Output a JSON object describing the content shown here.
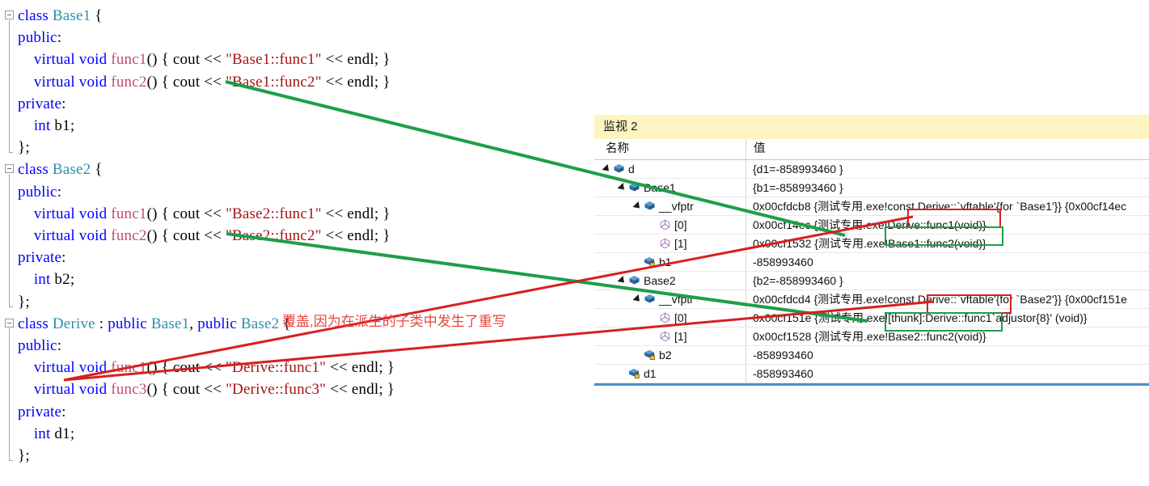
{
  "code": {
    "lines": [
      {
        "indent": 0,
        "tokens": [
          {
            "t": "class ",
            "c": "kw"
          },
          {
            "t": "Base1",
            "c": "typ"
          },
          {
            "t": " {",
            "c": "pl"
          }
        ]
      },
      {
        "indent": 0,
        "tokens": [
          {
            "t": "public",
            "c": "kw"
          },
          {
            "t": ":",
            "c": "pl"
          }
        ]
      },
      {
        "indent": 0,
        "tokens": [
          {
            "t": "    ",
            "c": "pl"
          },
          {
            "t": "virtual void ",
            "c": "kw"
          },
          {
            "t": "func1",
            "c": "fn"
          },
          {
            "t": "() { cout << ",
            "c": "pl"
          },
          {
            "t": "\"Base1::func1\"",
            "c": "str"
          },
          {
            "t": " << endl; }",
            "c": "pl"
          }
        ]
      },
      {
        "indent": 0,
        "tokens": [
          {
            "t": "    ",
            "c": "pl"
          },
          {
            "t": "virtual void ",
            "c": "kw"
          },
          {
            "t": "func2",
            "c": "fn"
          },
          {
            "t": "() { cout << ",
            "c": "pl"
          },
          {
            "t": "\"Base1::func2\"",
            "c": "str"
          },
          {
            "t": " << endl; }",
            "c": "pl"
          }
        ]
      },
      {
        "indent": 0,
        "tokens": [
          {
            "t": "private",
            "c": "kw"
          },
          {
            "t": ":",
            "c": "pl"
          }
        ]
      },
      {
        "indent": 0,
        "tokens": [
          {
            "t": "    ",
            "c": "pl"
          },
          {
            "t": "int ",
            "c": "kw"
          },
          {
            "t": "b1;",
            "c": "pl"
          }
        ]
      },
      {
        "indent": 0,
        "tokens": [
          {
            "t": "};",
            "c": "pl"
          }
        ]
      },
      {
        "indent": 0,
        "tokens": [
          {
            "t": "class ",
            "c": "kw"
          },
          {
            "t": "Base2",
            "c": "typ"
          },
          {
            "t": " {",
            "c": "pl"
          }
        ]
      },
      {
        "indent": 0,
        "tokens": [
          {
            "t": "public",
            "c": "kw"
          },
          {
            "t": ":",
            "c": "pl"
          }
        ]
      },
      {
        "indent": 0,
        "tokens": [
          {
            "t": "    ",
            "c": "pl"
          },
          {
            "t": "virtual void ",
            "c": "kw"
          },
          {
            "t": "func1",
            "c": "fn"
          },
          {
            "t": "() { cout << ",
            "c": "pl"
          },
          {
            "t": "\"Base2::func1\"",
            "c": "str"
          },
          {
            "t": " << endl; }",
            "c": "pl"
          }
        ]
      },
      {
        "indent": 0,
        "tokens": [
          {
            "t": "    ",
            "c": "pl"
          },
          {
            "t": "virtual void ",
            "c": "kw"
          },
          {
            "t": "func2",
            "c": "fn"
          },
          {
            "t": "() { cout << ",
            "c": "pl"
          },
          {
            "t": "\"Base2::func2\"",
            "c": "str"
          },
          {
            "t": " << endl; }",
            "c": "pl"
          }
        ]
      },
      {
        "indent": 0,
        "tokens": [
          {
            "t": "private",
            "c": "kw"
          },
          {
            "t": ":",
            "c": "pl"
          }
        ]
      },
      {
        "indent": 0,
        "tokens": [
          {
            "t": "    ",
            "c": "pl"
          },
          {
            "t": "int ",
            "c": "kw"
          },
          {
            "t": "b2;",
            "c": "pl"
          }
        ]
      },
      {
        "indent": 0,
        "tokens": [
          {
            "t": "};",
            "c": "pl"
          }
        ]
      },
      {
        "indent": 0,
        "tokens": [
          {
            "t": "class ",
            "c": "kw"
          },
          {
            "t": "Derive",
            "c": "typ"
          },
          {
            "t": " : ",
            "c": "pl"
          },
          {
            "t": "public ",
            "c": "kw"
          },
          {
            "t": "Base1",
            "c": "typ"
          },
          {
            "t": ", ",
            "c": "pl"
          },
          {
            "t": "public ",
            "c": "kw"
          },
          {
            "t": "Base2",
            "c": "typ"
          },
          {
            "t": " {",
            "c": "pl"
          }
        ]
      },
      {
        "indent": 0,
        "tokens": [
          {
            "t": "public",
            "c": "kw"
          },
          {
            "t": ":",
            "c": "pl"
          }
        ]
      },
      {
        "indent": 0,
        "tokens": [
          {
            "t": "    ",
            "c": "pl"
          },
          {
            "t": "virtual void ",
            "c": "kw"
          },
          {
            "t": "func1",
            "c": "fn"
          },
          {
            "t": "() { cout << ",
            "c": "pl"
          },
          {
            "t": "\"Derive::func1\"",
            "c": "str"
          },
          {
            "t": " << endl; }",
            "c": "pl"
          }
        ]
      },
      {
        "indent": 0,
        "tokens": [
          {
            "t": "    ",
            "c": "pl"
          },
          {
            "t": "virtual void ",
            "c": "kw"
          },
          {
            "t": "func3",
            "c": "fn"
          },
          {
            "t": "() { cout << ",
            "c": "pl"
          },
          {
            "t": "\"Derive::func3\"",
            "c": "str"
          },
          {
            "t": " << endl; }",
            "c": "pl"
          }
        ]
      },
      {
        "indent": 0,
        "tokens": [
          {
            "t": "private",
            "c": "kw"
          },
          {
            "t": ":",
            "c": "pl"
          }
        ]
      },
      {
        "indent": 0,
        "tokens": [
          {
            "t": "    ",
            "c": "pl"
          },
          {
            "t": "int ",
            "c": "kw"
          },
          {
            "t": "d1;",
            "c": "pl"
          }
        ]
      },
      {
        "indent": 0,
        "tokens": [
          {
            "t": "};",
            "c": "pl"
          }
        ]
      }
    ]
  },
  "annotation": {
    "note_text": "覆盖,因为在派生的子类中发生了重写",
    "note_color": "#e8453c",
    "green_color": "#1e9e4a",
    "red_color": "#d62020"
  },
  "watch": {
    "title": "监视 2",
    "columns": {
      "name": "名称",
      "value": "值"
    },
    "rows": [
      {
        "depth": 0,
        "expander": "expanded",
        "icon": "object-icon",
        "name": "d",
        "value": "{d1=-858993460 }"
      },
      {
        "depth": 1,
        "expander": "expanded",
        "icon": "object-icon",
        "name": "Base1",
        "value": "{b1=-858993460 }"
      },
      {
        "depth": 2,
        "expander": "expanded",
        "icon": "object-icon",
        "name": "__vfptr",
        "value": "0x00cfdcb8 {测试专用.exe!const Derive::`vftable'{for `Base1'}} {0x00cf14ec"
      },
      {
        "depth": 3,
        "expander": "none",
        "icon": "pointer-value-icon",
        "name": "[0]",
        "value": "0x00cf14ec {测试专用.exe!Derive::func1(void)}"
      },
      {
        "depth": 3,
        "expander": "none",
        "icon": "pointer-value-icon",
        "name": "[1]",
        "value": "0x00cf1532 {测试专用.exe!Base1::func2(void)}"
      },
      {
        "depth": 2,
        "expander": "none",
        "icon": "private-field-icon",
        "name": "b1",
        "value": "-858993460"
      },
      {
        "depth": 1,
        "expander": "expanded",
        "icon": "object-icon",
        "name": "Base2",
        "value": "{b2=-858993460 }"
      },
      {
        "depth": 2,
        "expander": "expanded",
        "icon": "object-icon",
        "name": "__vfptr",
        "value": "0x00cfdcd4 {测试专用.exe!const Derive::`vftable'{for `Base2'}} {0x00cf151e"
      },
      {
        "depth": 3,
        "expander": "none",
        "icon": "pointer-value-icon",
        "name": "[0]",
        "value": "0x00cf151e {测试专用.exe![thunk]:Derive::func1`adjustor{8}' (void)}"
      },
      {
        "depth": 3,
        "expander": "none",
        "icon": "pointer-value-icon",
        "name": "[1]",
        "value": "0x00cf1528 {测试专用.exe!Base2::func2(void)}"
      },
      {
        "depth": 2,
        "expander": "none",
        "icon": "private-field-icon",
        "name": "b2",
        "value": "-858993460"
      },
      {
        "depth": 1,
        "expander": "none",
        "icon": "private-field-icon",
        "name": "d1",
        "value": "-858993460"
      }
    ]
  }
}
